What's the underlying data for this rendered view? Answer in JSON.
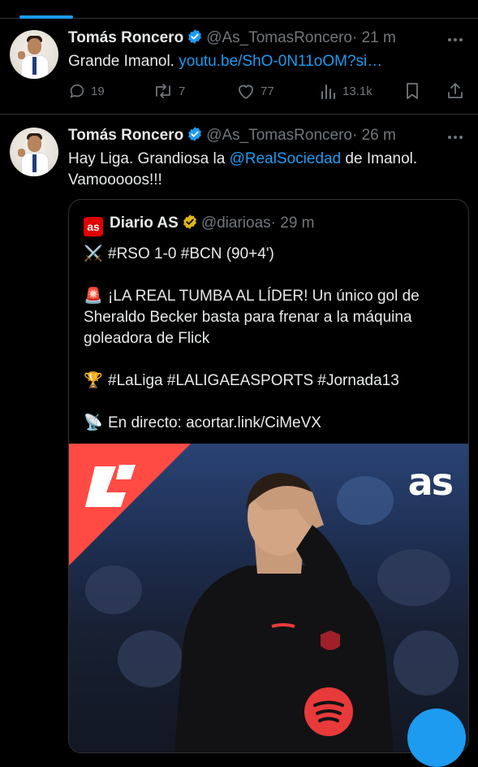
{
  "tweets": [
    {
      "author": "Tomás Roncero",
      "handle": "@As_TomasRoncero",
      "time": "· 21 m",
      "text": "Grande Imanol. ",
      "link": "youtu.be/ShO-0N11oOM?si…",
      "replies": "19",
      "retweets": "7",
      "likes": "77",
      "views": "13.1k"
    },
    {
      "author": "Tomás Roncero",
      "handle": "@As_TomasRoncero",
      "time": "· 26 m",
      "text_before": "Hay Liga. Grandiosa la ",
      "mention": "@RealSociedad",
      "text_after": " de Imanol.",
      "text_line2": "Vamooooos!!!"
    }
  ],
  "quote": {
    "author": "Diario AS",
    "badge": "as",
    "handle": "@diarioas",
    "time": "· 29 m",
    "line1": "#RSO 1-0 #BCN (90+4')",
    "line2a": "¡LA REAL TUMBA AL LÍDER! Un único gol de",
    "line2b": "Sheraldo Becker basta para frenar a la máquina",
    "line2c": "goleadora de Flick",
    "line3": "#LaLiga #LALIGAEASPORTS #Jornada13",
    "line4": "En directo: acortar.link/CiMeVX",
    "emoji1": "⚔️",
    "emoji2": "🚨",
    "emoji3": "🏆",
    "emoji4": "📡",
    "media_watermark": "as"
  },
  "colors": {
    "accent": "#1d9bf0",
    "verified_blue": "#1d9bf0",
    "verified_gold": "#e2b719",
    "muted": "#71767b",
    "divider": "#2f3336"
  }
}
